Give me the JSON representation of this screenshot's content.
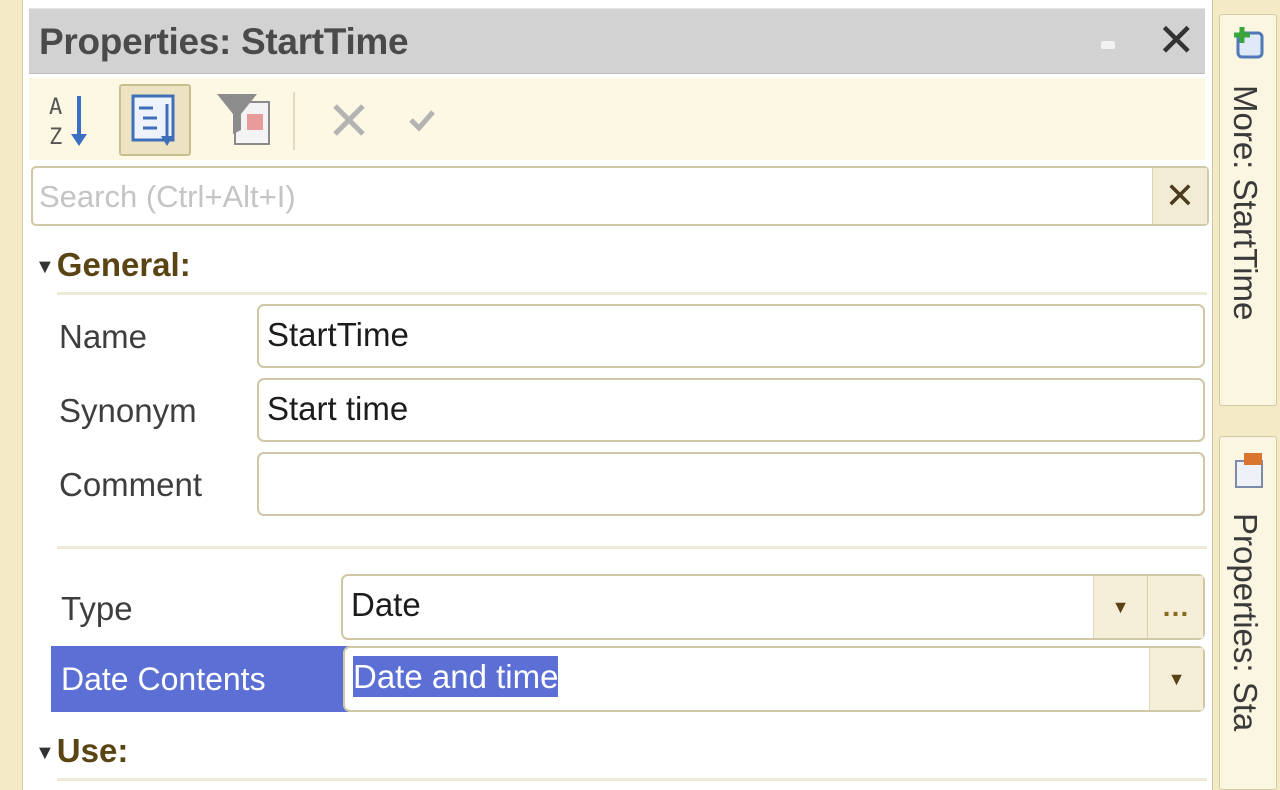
{
  "panel": {
    "title": "Properties: StartTime",
    "toolbar": {
      "buttons": [
        "sort-az-icon",
        "categories-icon",
        "filter-icon",
        "cancel-x-icon",
        "apply-check-icon"
      ]
    },
    "search": {
      "placeholder": "Search (Ctrl+Alt+I)",
      "value": ""
    }
  },
  "groups": {
    "general": {
      "label": "General:",
      "fields": {
        "name": {
          "label": "Name",
          "value": "StartTime"
        },
        "synonym": {
          "label": "Synonym",
          "value": "Start time"
        },
        "comment": {
          "label": "Comment",
          "value": ""
        },
        "type": {
          "label": "Type",
          "value": "Date"
        },
        "date_contents": {
          "label": "Date Contents",
          "value": "Date and time"
        }
      }
    },
    "use": {
      "label": "Use:"
    }
  },
  "right_tabs": {
    "more": "More: StartTime",
    "properties": "Properties: Sta"
  },
  "colors": {
    "selection": "#5b6fd4",
    "title_bar": "#d2d2d2",
    "frame": "#fbf4d4"
  }
}
